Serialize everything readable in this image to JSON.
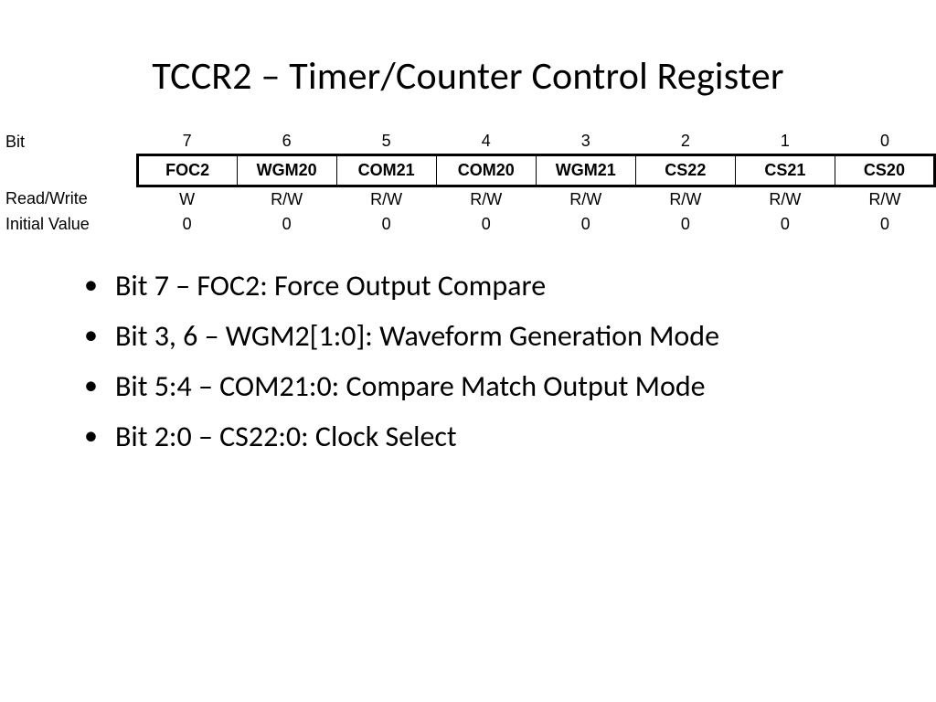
{
  "title": "TCCR2 – Timer/Counter Control Register",
  "reg": {
    "bit_label": "Bit",
    "rw_label": "Read/Write",
    "iv_label": "Initial Value",
    "bits": [
      "7",
      "6",
      "5",
      "4",
      "3",
      "2",
      "1",
      "0"
    ],
    "names": [
      "FOC2",
      "WGM20",
      "COM21",
      "COM20",
      "WGM21",
      "CS22",
      "CS21",
      "CS20"
    ],
    "rw": [
      "W",
      "R/W",
      "R/W",
      "R/W",
      "R/W",
      "R/W",
      "R/W",
      "R/W"
    ],
    "initial": [
      "0",
      "0",
      "0",
      "0",
      "0",
      "0",
      "0",
      "0"
    ]
  },
  "bullets": [
    "Bit 7 – FOC2: Force Output Compare",
    "Bit 3, 6 – WGM2[1:0]: Waveform Generation Mode",
    "Bit 5:4 – COM21:0: Compare Match Output Mode",
    "Bit 2:0 – CS22:0: Clock Select"
  ]
}
